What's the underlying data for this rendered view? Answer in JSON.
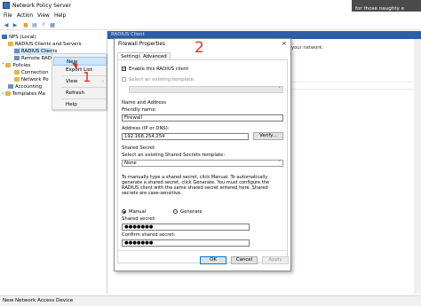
{
  "window": {
    "title": "Network Policy Server"
  },
  "banner": {
    "ghost": "...",
    "text": "for those naughty e"
  },
  "menu": [
    "File",
    "Action",
    "View",
    "Help"
  ],
  "tree": {
    "root": "NPS (Local)",
    "radius": "RADIUS Clients and Servers",
    "clients": "RADIUS Clients",
    "remote": "Remote RAD",
    "policies": "Policies",
    "connection": "Connection",
    "network": "Network Po",
    "accounting": "Accounting",
    "templates": "Templates Ma"
  },
  "context_menu": {
    "new": "New",
    "export": "Export List",
    "view": "View",
    "refresh": "Refresh",
    "help": "Help"
  },
  "right_pane": {
    "header": "RADIUS Client",
    "text": "your network."
  },
  "annotations": {
    "one": "1",
    "two": "2"
  },
  "dialog": {
    "title": "Firewall Properties",
    "close": "×",
    "tabs": [
      "Settings",
      "Advanced"
    ],
    "enable_label": "Enable this RADIUS client",
    "enable_checked": "✓",
    "select_existing_label": "Select an existing template:",
    "name_section": "Name and Address",
    "friendly_label": "Friendly name:",
    "friendly_value": "Firewall",
    "address_label": "Address (IP or DNS):",
    "address_value": "192.168.254.254",
    "verify": "Verify...",
    "shared_secret_section": "Shared Secret",
    "secret_template_label": "Select an existing Shared Secrets template:",
    "secret_template_value": "None",
    "instructions": "To manually type a shared secret, click Manual. To automatically generate a shared secret, click Generate. You must configure the RADIUS client with the same shared secret entered here. Shared secrets are case-sensitive.",
    "manual": "Manual",
    "generate": "Generate",
    "shared_label": "Shared secret:",
    "shared_value": "●●●●●●●",
    "confirm_label": "Confirm shared secret:",
    "confirm_value": "●●●●●●●",
    "ok": "OK",
    "cancel": "Cancel",
    "apply": "Apply"
  },
  "status": "New Network Access Device"
}
